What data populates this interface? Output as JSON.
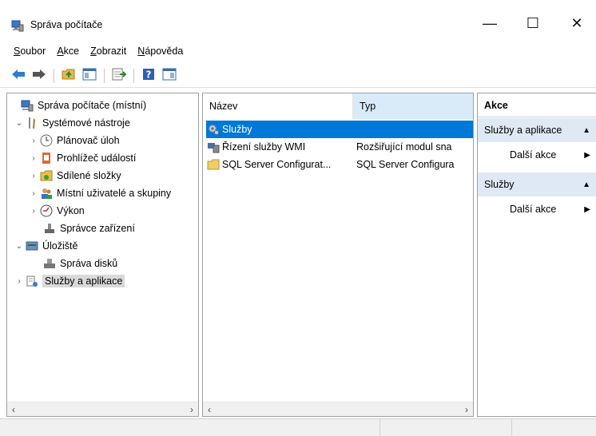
{
  "window": {
    "title": "Správa počítače",
    "minimize_glyph": "—",
    "maximize_glyph": "☐",
    "close_glyph": "✕"
  },
  "menu": [
    {
      "accel": "S",
      "rest": "oubor"
    },
    {
      "accel": "A",
      "rest": "kce"
    },
    {
      "accel": "Z",
      "rest": "obrazit"
    },
    {
      "accel": "N",
      "rest": "ápověda"
    }
  ],
  "toolbar": {
    "icons": [
      "back-arrow-icon",
      "forward-arrow-icon",
      "up-folder-icon",
      "show-hide-tree-icon",
      "export-list-icon",
      "help-icon",
      "show-hide-action-pane-icon"
    ]
  },
  "tree": {
    "items": [
      {
        "label": "Správa počítače (místní)",
        "icon": "computer-management-icon",
        "expander": ""
      },
      {
        "label": "Systémové nástroje",
        "icon": "system-tools-icon",
        "expander": "⌄"
      },
      {
        "label": "Plánovač úloh",
        "icon": "task-scheduler-icon",
        "expander": "›"
      },
      {
        "label": "Prohlížeč událostí",
        "icon": "event-viewer-icon",
        "expander": "›"
      },
      {
        "label": "Sdílené složky",
        "icon": "shared-folders-icon",
        "expander": "›"
      },
      {
        "label": "Místní uživatelé a skupiny",
        "icon": "local-users-icon",
        "expander": "›"
      },
      {
        "label": "Výkon",
        "icon": "performance-icon",
        "expander": "›"
      },
      {
        "label": "Správce zařízení",
        "icon": "device-manager-icon",
        "expander": ""
      },
      {
        "label": "Úložiště",
        "icon": "storage-icon",
        "expander": "⌄"
      },
      {
        "label": "Správa disků",
        "icon": "disk-management-icon",
        "expander": ""
      },
      {
        "label": "Služby a aplikace",
        "icon": "services-apps-icon",
        "expander": "›"
      }
    ]
  },
  "list": {
    "columns": {
      "name": "Název",
      "type": "Typ"
    },
    "rows": [
      {
        "name": "Služby",
        "type": "",
        "icon": "services-gear-icon"
      },
      {
        "name": "Řízení služby WMI",
        "type": "Rozšiřující modul sna",
        "icon": "wmi-control-icon"
      },
      {
        "name": "SQL Server Configurat...",
        "type": "SQL Server Configura",
        "icon": "folder-icon"
      }
    ]
  },
  "scroll": {
    "left": "‹",
    "right": "›"
  },
  "actions": {
    "header": "Akce",
    "sections": [
      {
        "title": "Služby a aplikace",
        "item": "Další akce"
      },
      {
        "title": "Služby",
        "item": "Další akce"
      }
    ],
    "collapse_glyph": "▲",
    "more_glyph": "▶"
  },
  "colors": {
    "selection": "#0078d7",
    "column_highlight": "#d9ebf9",
    "action_section": "#dfe9f5"
  }
}
